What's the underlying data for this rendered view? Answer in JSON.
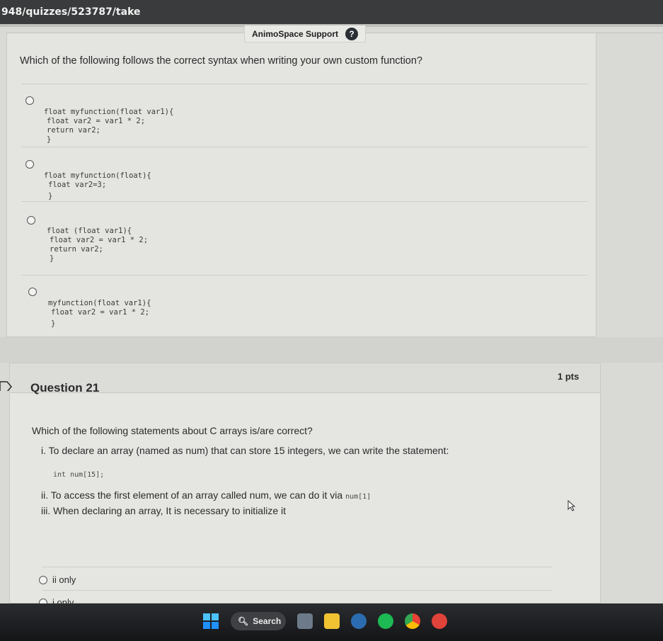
{
  "browser": {
    "url": "948/quizzes/523787/take"
  },
  "support": {
    "label": "AnimoSpace Support",
    "help": "?"
  },
  "prev_question": {
    "text": "Which of the following follows the correct syntax when writing your own custom function?",
    "answers": [
      {
        "lines": [
          "float myfunction(float var1){",
          "float var2 = var1 * 2;",
          "return var2;",
          "}"
        ]
      },
      {
        "lines": [
          "float myfunction(float){",
          "float var2=3;",
          "}"
        ]
      },
      {
        "lines": [
          "float (float var1){",
          "float var2 = var1 * 2;",
          "return var2;",
          "}"
        ]
      },
      {
        "lines": [
          "myfunction(float var1){",
          "float var2 = var1 * 2;",
          "}"
        ]
      }
    ]
  },
  "question21": {
    "title": "Question 21",
    "points": "1 pts",
    "prompt": "Which of the following statements about C arrays is/are correct?",
    "s1": "i. To declare an array (named as num) that can store 15 integers, we can write the statement:",
    "s1_code": "int num[15];",
    "s2": "ii. To access the first element of an array called num, we can do it via",
    "s2_code": "num[1]",
    "s3": "iii. When declaring an array, It is necessary to initialize it",
    "options": [
      "ii only",
      "i only"
    ]
  },
  "taskbar": {
    "search_label": "Search"
  },
  "colors": {
    "accent": "#2b2b2b",
    "taskbar": "#1c1d1f"
  }
}
